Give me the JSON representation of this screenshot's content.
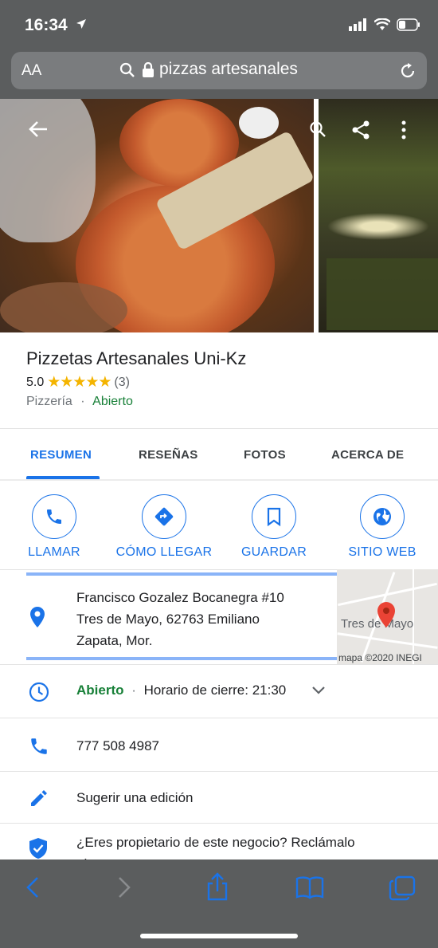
{
  "status": {
    "time": "16:34"
  },
  "browser": {
    "text_size": "AA",
    "url": "pizzas artesanales"
  },
  "place": {
    "name": "Pizzetas Artesanales Uni-Kz",
    "rating": "5.0",
    "stars": "★★★★★",
    "reviews": "(3)",
    "category": "Pizzería",
    "separator": "·",
    "status": "Abierto"
  },
  "tabs": [
    {
      "label": "RESUMEN"
    },
    {
      "label": "RESEÑAS"
    },
    {
      "label": "FOTOS"
    },
    {
      "label": "ACERCA DE"
    }
  ],
  "actions": [
    {
      "label": "LLAMAR",
      "icon": "phone-icon"
    },
    {
      "label": "CÓMO LLEGAR",
      "icon": "directions-icon"
    },
    {
      "label": "GUARDAR",
      "icon": "bookmark-icon"
    },
    {
      "label": "SITIO WEB",
      "icon": "globe-icon"
    }
  ],
  "address": {
    "line1": "Francisco Gozalez Bocanegra #10",
    "line2": "Tres de Mayo, 62763 Emiliano",
    "line3": "Zapata, Mor."
  },
  "map": {
    "label": "Tres de Mayo",
    "copyright": "mapa ©2020 INEGI"
  },
  "hours": {
    "status": "Abierto",
    "separator": "·",
    "closing": "Horario de cierre: 21:30"
  },
  "phone": "777 508 4987",
  "suggest_edit": "Sugerir una edición",
  "claim": {
    "line1": "¿Eres propietario de este negocio? Reclámalo",
    "line2": "ahora"
  },
  "colors": {
    "accent": "#1a73e8",
    "open": "#188038",
    "star": "#f4b400",
    "chrome": "#5b5d5e"
  }
}
